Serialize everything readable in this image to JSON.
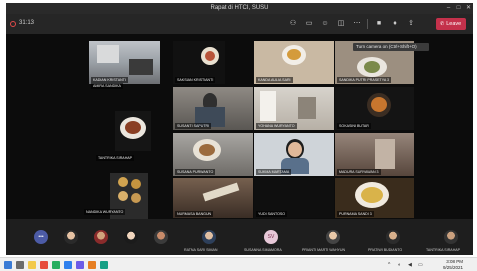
{
  "window": {
    "title": "Rapat di HTCI, SUSU"
  },
  "toolbar": {
    "timer": "31:13",
    "leave_label": "Leave"
  },
  "tooltip": "Turn camera on (Ctrl+Shift+O)",
  "tiles": [
    {
      "name": "KADIAN KRISTANTI"
    },
    {
      "name": "SAKSIAN KRISTIANTI"
    },
    {
      "name": "KANDA AULIA SARI"
    },
    {
      "name": "SANDIKA PUTRI PRASETYA 3"
    },
    {
      "name": "SUSANTI SAPUTRI"
    },
    {
      "name": "YOHANA WURYANTO"
    },
    {
      "name": "AMIRA SANDIKA"
    },
    {
      "name": "SOKASINI BUTAR"
    },
    {
      "name": "TANTRIKA SIRAHAP"
    },
    {
      "name": "SUSANA PURWANTO"
    },
    {
      "name": "SUKMA MARTAMA"
    },
    {
      "name": "MADURA SURYAWAN 3"
    },
    {
      "name": "NANDIKA WURYANTO"
    },
    {
      "name": "NURMASA BANGUN"
    },
    {
      "name": "YUDI SANTOSO"
    },
    {
      "name": "PURNAMA SANDI 3"
    }
  ],
  "strip": {
    "sv_initials": "SV",
    "names": [
      "RATNA SARI SIMAN",
      "SUSANNA SIMAMORA",
      "PRIANTI MARTI WAHYUN",
      "PRATIWI BUDIANTO",
      "TANTRIKA SIRAHAP"
    ]
  },
  "taskbar": {
    "time": "3:08 PM",
    "date": "9/25/2021"
  }
}
